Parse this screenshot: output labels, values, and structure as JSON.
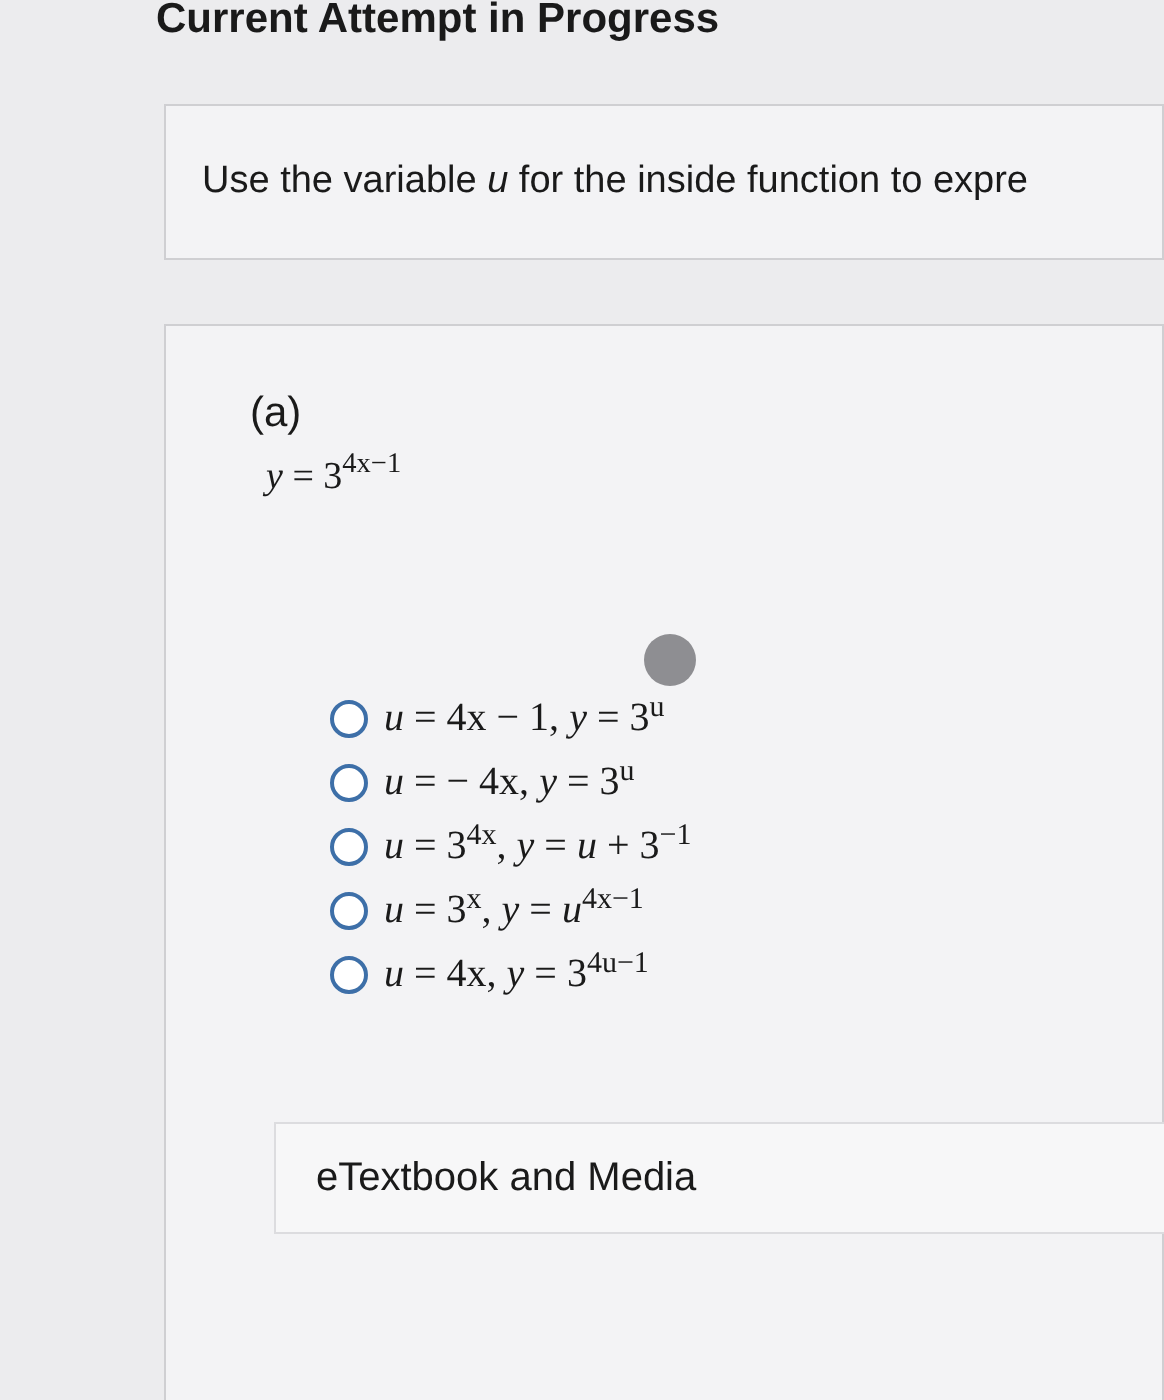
{
  "header": {
    "title": "Current Attempt in Progress"
  },
  "instructions": {
    "text": "Use the variable *u* for the inside function to expre"
  },
  "question": {
    "part_label": "(a)",
    "equation": "*y* = 3$^{4x−1}$",
    "options": [
      {
        "text": "*u* = 4x − 1,  *y* = 3$^{u}$",
        "selected": false
      },
      {
        "text": "*u* =  − 4x,  *y* = 3$^{u}$",
        "selected": false
      },
      {
        "text": "*u* = 3$^{4x}$,  *y* = *u* + 3$^{−1}$",
        "selected": false
      },
      {
        "text": "*u* = 3$^{x}$,  *y* = *u*$^{4x−1}$",
        "selected": false
      },
      {
        "text": "*u* = 4x,  *y* = 3$^{4u−1}$",
        "selected": false
      }
    ]
  },
  "resources": {
    "label": "eTextbook and Media"
  }
}
